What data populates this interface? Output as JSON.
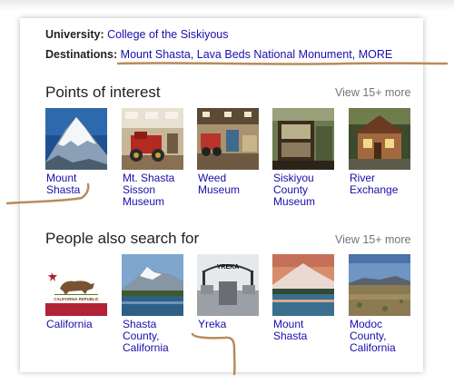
{
  "info": {
    "university_label": "University:",
    "university_value": "College of the Siskiyous",
    "destinations_label": "Destinations:",
    "destinations": [
      "Mount Shasta",
      "Lava Beds National Monument",
      "MORE"
    ]
  },
  "points_of_interest": {
    "title": "Points of interest",
    "view_more": "View 15+ more",
    "items": [
      {
        "label": "Mount\nShasta"
      },
      {
        "label": "Mt. Shasta\nSisson\nMuseum"
      },
      {
        "label": "Weed\nMuseum"
      },
      {
        "label": "Siskiyou\nCounty\nMuseum"
      },
      {
        "label": "River\nExchange"
      }
    ]
  },
  "people_also_search": {
    "title": "People also search for",
    "view_more": "View 15+ more",
    "items": [
      {
        "label": "California",
        "flag_text": "CALIFORNIA REPUBLIC"
      },
      {
        "label": "Shasta\nCounty,\nCalifornia"
      },
      {
        "label": "Yreka",
        "sign_text": "YREKA"
      },
      {
        "label": "Mount\nShasta"
      },
      {
        "label": "Modoc\nCounty,\nCalifornia"
      }
    ]
  },
  "colors": {
    "link": "#1a0dab",
    "annotation_pen": "#b98a5c",
    "muted": "#70757a"
  }
}
